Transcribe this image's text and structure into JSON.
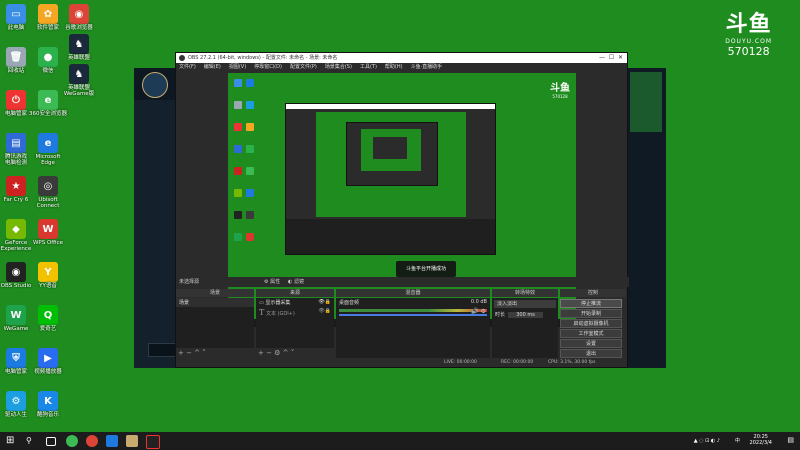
{
  "desktop": {
    "col1": [
      {
        "label": "此电脑",
        "color": "#3a8ee6",
        "glyph": "▭"
      },
      {
        "label": "回收站",
        "color": "#9aa8b5",
        "glyph": "🗑"
      },
      {
        "label": "电脑管家",
        "color": "#e33",
        "glyph": "⏻"
      },
      {
        "label": "腾讯游戏\n电脑检测",
        "color": "#2f6bd6",
        "glyph": "▤"
      },
      {
        "label": "Far Cry 6",
        "color": "#c22",
        "glyph": "★"
      },
      {
        "label": "GeForce\nExperience",
        "color": "#76b900",
        "glyph": "◆"
      },
      {
        "label": "OBS Studio",
        "color": "#222",
        "glyph": "◉"
      },
      {
        "label": "WeGame",
        "color": "#1fa34a",
        "glyph": "W"
      },
      {
        "label": "电脑管家",
        "color": "#1c7be0",
        "glyph": "⛨"
      },
      {
        "label": "驱动人生",
        "color": "#1c9fe0",
        "glyph": "⚙"
      }
    ],
    "col2": [
      {
        "label": "软件管家",
        "color": "#f5a623",
        "glyph": "✿"
      },
      {
        "label": "微信",
        "color": "#2bb24c",
        "glyph": "●"
      },
      {
        "label": "360安全浏览器",
        "color": "#3cba54",
        "glyph": "e"
      },
      {
        "label": "Microsoft\nEdge",
        "color": "#1f7ae0",
        "glyph": "e"
      },
      {
        "label": "Ubisoft\nConnect",
        "color": "#3a3a3a",
        "glyph": "◎"
      },
      {
        "label": "WPS Office",
        "color": "#d9382e",
        "glyph": "W"
      },
      {
        "label": "YY语音",
        "color": "#f2c200",
        "glyph": "Y"
      },
      {
        "label": "爱奇艺",
        "color": "#00be06",
        "glyph": "Q"
      },
      {
        "label": "视频播放器",
        "color": "#2a6cf0",
        "glyph": "▶"
      },
      {
        "label": "酷狗音乐",
        "color": "#1a88e8",
        "glyph": "K"
      }
    ],
    "col3": [
      {
        "label": "谷歌浏览器",
        "color": "#db4437",
        "glyph": "◉"
      },
      {
        "label": "英雄联盟",
        "color": "#1b2a3a",
        "glyph": "♞"
      },
      {
        "label": "英雄联盟\nWeGame版",
        "color": "#1b2a3a",
        "glyph": "♞"
      }
    ]
  },
  "watermark": {
    "logo": "斗鱼",
    "sub": "DOUYU.COM",
    "room": "570128"
  },
  "obs": {
    "title": "OBS 27.2.1 (64-bit, windows) - 配置文件: 未命名 - 场景: 未命名",
    "menu": [
      "文件(F)",
      "编辑(E)",
      "视图(V)",
      "停靠窗口(D)",
      "配置文件(P)",
      "场景集合(S)",
      "工具(T)",
      "帮助(H)",
      "斗鱼·直播助手"
    ],
    "notice": "斗鱼平台开播成功",
    "no_source": "未选择源",
    "prop_btn": "属性",
    "filter_btn": "滤镜",
    "docks": {
      "scenes": "场景",
      "sources": "来源",
      "mixer": "混音器",
      "transitions": "转场特效",
      "controls": "控制"
    },
    "scene_item": "场景",
    "sources": [
      {
        "name": "显示器采集",
        "icon": "monitor-icon"
      },
      {
        "name": "文本 (GDI+)",
        "icon": "text-icon"
      }
    ],
    "mixer_track": "桌面音频",
    "mixer_db": "0.0 dB",
    "transition_select": "淡入淡出",
    "duration_label": "时长",
    "duration_value": "300 ms",
    "controls": [
      "停止推流",
      "开始录制",
      "启动虚拟摄像机",
      "工作室模式",
      "设置",
      "退出"
    ],
    "status": {
      "live": "LIVE: 00:00:00",
      "rec": "REC: 00:00:00",
      "cpu": "CPU: 3.1%, 30.00 fps"
    }
  },
  "taskbar": {
    "time": "20:25",
    "date": "2022/3/4",
    "lang": "中"
  }
}
